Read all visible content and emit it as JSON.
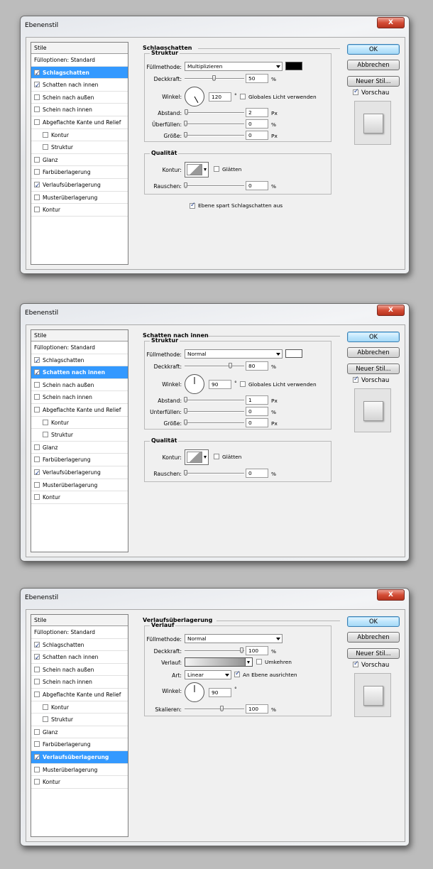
{
  "dialogs": [
    {
      "title": "Ebenenstil",
      "close_label": "X",
      "style_list": {
        "header": "Stile",
        "items": [
          {
            "label": "Fülloptionen: Standard",
            "checkbox": false,
            "checked": false,
            "selected": false,
            "sub": false
          },
          {
            "label": "Schlagschatten",
            "checkbox": true,
            "checked": true,
            "selected": true,
            "sub": false
          },
          {
            "label": "Schatten nach innen",
            "checkbox": true,
            "checked": true,
            "selected": false,
            "sub": false
          },
          {
            "label": "Schein nach außen",
            "checkbox": true,
            "checked": false,
            "selected": false,
            "sub": false
          },
          {
            "label": "Schein nach innen",
            "checkbox": true,
            "checked": false,
            "selected": false,
            "sub": false
          },
          {
            "label": "Abgeflachte Kante und Relief",
            "checkbox": true,
            "checked": false,
            "selected": false,
            "sub": false
          },
          {
            "label": "Kontur",
            "checkbox": true,
            "checked": false,
            "selected": false,
            "sub": true
          },
          {
            "label": "Struktur",
            "checkbox": true,
            "checked": false,
            "selected": false,
            "sub": true
          },
          {
            "label": "Glanz",
            "checkbox": true,
            "checked": false,
            "selected": false,
            "sub": false
          },
          {
            "label": "Farbüberlagerung",
            "checkbox": true,
            "checked": false,
            "selected": false,
            "sub": false
          },
          {
            "label": "Verlaufsüberlagerung",
            "checkbox": true,
            "checked": true,
            "selected": false,
            "sub": false
          },
          {
            "label": "Musterüberlagerung",
            "checkbox": true,
            "checked": false,
            "selected": false,
            "sub": false
          },
          {
            "label": "Kontur",
            "checkbox": true,
            "checked": false,
            "selected": false,
            "sub": false
          }
        ]
      },
      "panel": {
        "section_title": "Schlagschatten",
        "structure": {
          "title": "Struktur",
          "blend_mode_label": "Füllmethode:",
          "blend_mode": "Multiplizieren",
          "color": "#000000",
          "opacity_label": "Deckkraft:",
          "opacity": "50",
          "opacity_unit": "%",
          "angle_label": "Winkel:",
          "angle": "120",
          "angle_unit": "°",
          "global_light_label": "Globales Licht verwenden",
          "global_light": false,
          "distance_label": "Abstand:",
          "distance": "2",
          "distance_unit": "Px",
          "spread_label": "Überfüllen:",
          "spread": "0",
          "spread_unit": "%",
          "size_label": "Größe:",
          "size": "0",
          "size_unit": "Px"
        },
        "quality": {
          "title": "Qualität",
          "contour_label": "Kontur:",
          "antialias_label": "Glätten",
          "antialias": false,
          "noise_label": "Rauschen:",
          "noise": "0",
          "noise_unit": "%"
        },
        "knockout_label": "Ebene spart Schlagschatten aus",
        "knockout": true
      },
      "buttons": {
        "ok": "OK",
        "cancel": "Abbrechen",
        "new_style": "Neuer Stil..."
      },
      "preview_label": "Vorschau",
      "preview": true
    },
    {
      "title": "Ebenenstil",
      "close_label": "X",
      "style_list": {
        "header": "Stile",
        "items": [
          {
            "label": "Fülloptionen: Standard",
            "checkbox": false,
            "checked": false,
            "selected": false,
            "sub": false
          },
          {
            "label": "Schlagschatten",
            "checkbox": true,
            "checked": true,
            "selected": false,
            "sub": false
          },
          {
            "label": "Schatten nach innen",
            "checkbox": true,
            "checked": true,
            "selected": true,
            "sub": false
          },
          {
            "label": "Schein nach außen",
            "checkbox": true,
            "checked": false,
            "selected": false,
            "sub": false
          },
          {
            "label": "Schein nach innen",
            "checkbox": true,
            "checked": false,
            "selected": false,
            "sub": false
          },
          {
            "label": "Abgeflachte Kante und Relief",
            "checkbox": true,
            "checked": false,
            "selected": false,
            "sub": false
          },
          {
            "label": "Kontur",
            "checkbox": true,
            "checked": false,
            "selected": false,
            "sub": true
          },
          {
            "label": "Struktur",
            "checkbox": true,
            "checked": false,
            "selected": false,
            "sub": true
          },
          {
            "label": "Glanz",
            "checkbox": true,
            "checked": false,
            "selected": false,
            "sub": false
          },
          {
            "label": "Farbüberlagerung",
            "checkbox": true,
            "checked": false,
            "selected": false,
            "sub": false
          },
          {
            "label": "Verlaufsüberlagerung",
            "checkbox": true,
            "checked": true,
            "selected": false,
            "sub": false
          },
          {
            "label": "Musterüberlagerung",
            "checkbox": true,
            "checked": false,
            "selected": false,
            "sub": false
          },
          {
            "label": "Kontur",
            "checkbox": true,
            "checked": false,
            "selected": false,
            "sub": false
          }
        ]
      },
      "panel": {
        "section_title": "Schatten nach innen",
        "structure": {
          "title": "Struktur",
          "blend_mode_label": "Füllmethode:",
          "blend_mode": "Normal",
          "color": "#ffffff",
          "opacity_label": "Deckkraft:",
          "opacity": "80",
          "opacity_unit": "%",
          "angle_label": "Winkel:",
          "angle": "90",
          "angle_unit": "°",
          "global_light_label": "Globales Licht verwenden",
          "global_light": false,
          "distance_label": "Abstand:",
          "distance": "1",
          "distance_unit": "Px",
          "spread_label": "Unterfüllen:",
          "spread": "0",
          "spread_unit": "%",
          "size_label": "Größe:",
          "size": "0",
          "size_unit": "Px"
        },
        "quality": {
          "title": "Qualität",
          "contour_label": "Kontur:",
          "antialias_label": "Glätten",
          "antialias": false,
          "noise_label": "Rauschen:",
          "noise": "0",
          "noise_unit": "%"
        }
      },
      "buttons": {
        "ok": "OK",
        "cancel": "Abbrechen",
        "new_style": "Neuer Stil..."
      },
      "preview_label": "Vorschau",
      "preview": true
    },
    {
      "title": "Ebenenstil",
      "close_label": "X",
      "style_list": {
        "header": "Stile",
        "items": [
          {
            "label": "Fülloptionen: Standard",
            "checkbox": false,
            "checked": false,
            "selected": false,
            "sub": false
          },
          {
            "label": "Schlagschatten",
            "checkbox": true,
            "checked": true,
            "selected": false,
            "sub": false
          },
          {
            "label": "Schatten nach innen",
            "checkbox": true,
            "checked": true,
            "selected": false,
            "sub": false
          },
          {
            "label": "Schein nach außen",
            "checkbox": true,
            "checked": false,
            "selected": false,
            "sub": false
          },
          {
            "label": "Schein nach innen",
            "checkbox": true,
            "checked": false,
            "selected": false,
            "sub": false
          },
          {
            "label": "Abgeflachte Kante und Relief",
            "checkbox": true,
            "checked": false,
            "selected": false,
            "sub": false
          },
          {
            "label": "Kontur",
            "checkbox": true,
            "checked": false,
            "selected": false,
            "sub": true
          },
          {
            "label": "Struktur",
            "checkbox": true,
            "checked": false,
            "selected": false,
            "sub": true
          },
          {
            "label": "Glanz",
            "checkbox": true,
            "checked": false,
            "selected": false,
            "sub": false
          },
          {
            "label": "Farbüberlagerung",
            "checkbox": true,
            "checked": false,
            "selected": false,
            "sub": false
          },
          {
            "label": "Verlaufsüberlagerung",
            "checkbox": true,
            "checked": true,
            "selected": true,
            "sub": false
          },
          {
            "label": "Musterüberlagerung",
            "checkbox": true,
            "checked": false,
            "selected": false,
            "sub": false
          },
          {
            "label": "Kontur",
            "checkbox": true,
            "checked": false,
            "selected": false,
            "sub": false
          }
        ]
      },
      "panel": {
        "section_title": "Verlaufsüberlagerung",
        "gradient": {
          "title": "Verlauf",
          "blend_mode_label": "Füllmethode:",
          "blend_mode": "Normal",
          "opacity_label": "Deckkraft:",
          "opacity": "100",
          "opacity_unit": "%",
          "gradient_label": "Verlauf:",
          "reverse_label": "Umkehren",
          "reverse": false,
          "style_label": "Art:",
          "style": "Linear",
          "align_label": "An Ebene ausrichten",
          "align": true,
          "angle_label": "Winkel:",
          "angle": "90",
          "angle_unit": "°",
          "scale_label": "Skalieren:",
          "scale": "100",
          "scale_unit": "%"
        }
      },
      "buttons": {
        "ok": "OK",
        "cancel": "Abbrechen",
        "new_style": "Neuer Stil..."
      },
      "preview_label": "Vorschau",
      "preview": true
    }
  ]
}
